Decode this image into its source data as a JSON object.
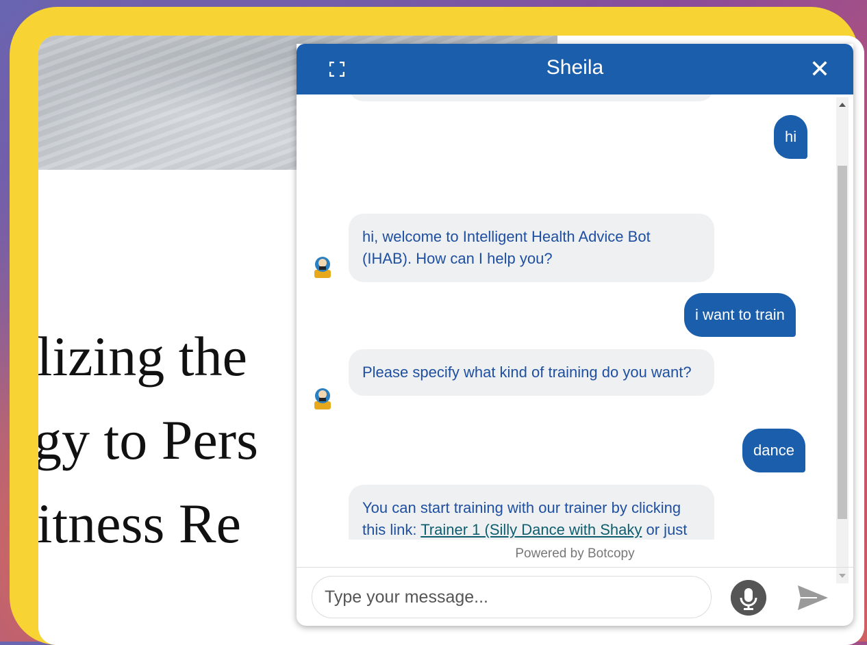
{
  "page": {
    "headline_lines": [
      "tilizing the",
      "ogy to Pers",
      "Fitness Re"
    ]
  },
  "chat": {
    "title": "Sheila",
    "expand_icon": "expand-icon",
    "close_icon": "close-icon",
    "close_label": "✕",
    "messages": [
      {
        "from": "user",
        "text": "hi"
      },
      {
        "from": "bot",
        "text": "hi, welcome to Intelligent Health Advice Bot (IHAB). How can I help you?"
      },
      {
        "from": "user",
        "text": "i want to train"
      },
      {
        "from": "bot",
        "text": "Please specify what kind of training do you want?"
      },
      {
        "from": "user",
        "text": "dance"
      },
      {
        "from": "bot",
        "text_before": "You can start training with our trainer by clicking this link: ",
        "link_text": "Trainer 1 (Silly Dance with Shaky",
        "text_after": " or just type anything below"
      }
    ],
    "powered_by": "Powered by Botcopy",
    "input": {
      "placeholder": "Type your message...",
      "value": ""
    },
    "mic_icon": "microphone-icon",
    "send_icon": "send-icon"
  },
  "colors": {
    "accent": "#1b5eac",
    "frame": "#f7d433",
    "bot_bubble": "#eef0f2"
  }
}
